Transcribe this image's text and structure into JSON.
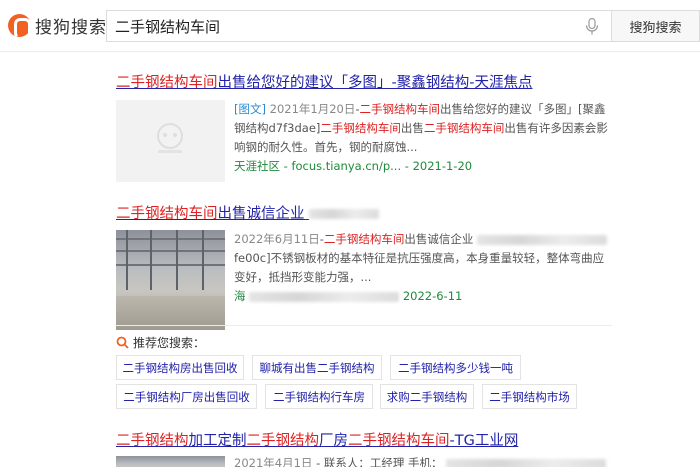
{
  "header": {
    "logo_text": "搜狗搜索",
    "search_value": "二手钢结构车间",
    "search_button": "搜狗搜索"
  },
  "results": [
    {
      "title_hl": "二手钢结构车间",
      "title_rest": "出售给您好的建议「多图」-聚鑫钢结构-天涯焦点",
      "tag": "[图文]",
      "date": "2021年1月20日",
      "snippet_1a": "-",
      "snippet_1b": "二手钢结构车间",
      "snippet_1c": "出售给您好的建议「多图」[聚鑫钢结构d7f3dae]",
      "snippet_2a": "二手钢结构车间",
      "snippet_2b": "出售",
      "snippet_2c": "二手钢结构车间",
      "snippet_2d": "出售有许多因素会影响钢的耐久性。首先，钢的耐腐蚀...",
      "cite": "天涯社区 - focus.tianya.cn/p... - 2021-1-20",
      "thumb_icon": "image-placeholder-icon"
    },
    {
      "title_hl": "二手钢结构车间",
      "title_rest": "出售诚信企业",
      "date": "2022年6月11日",
      "snippet_a": "-",
      "snippet_b": "二手钢结构车间",
      "snippet_c": "出售诚信企业",
      "snippet_d": "fe00c]不锈钢板材的基本特征是抗压强度高，本身重量较轻，整体弯曲应变好，抵挡形变能力强，...",
      "cite_prefix": "海",
      "cite_date": "2022-6-11"
    },
    {
      "title_hl_1": "二手钢结构",
      "title_mid_1": "加工定制",
      "title_hl_2": "二手钢结构",
      "title_mid_2": "厂房",
      "title_hl_3": "二手钢结构车间",
      "title_rest": "-TG工业网",
      "date": "2021年4月1日",
      "snippet": "- 联系人：工经理 手机："
    }
  ],
  "related": {
    "heading": "推荐您搜索：",
    "row1": [
      "二手钢结构房出售回收",
      "聊城有出售二手钢结构",
      "二手钢结构多少钱一吨"
    ],
    "row2": [
      "二手钢结构厂房出售回收",
      "二手钢结构行车房",
      "求购二手钢结构",
      "二手钢结构市场"
    ]
  },
  "colors": {
    "link": "#2222aa",
    "highlight": "#dd2222",
    "cite": "#1e8a3a",
    "brand": "#f26122"
  }
}
